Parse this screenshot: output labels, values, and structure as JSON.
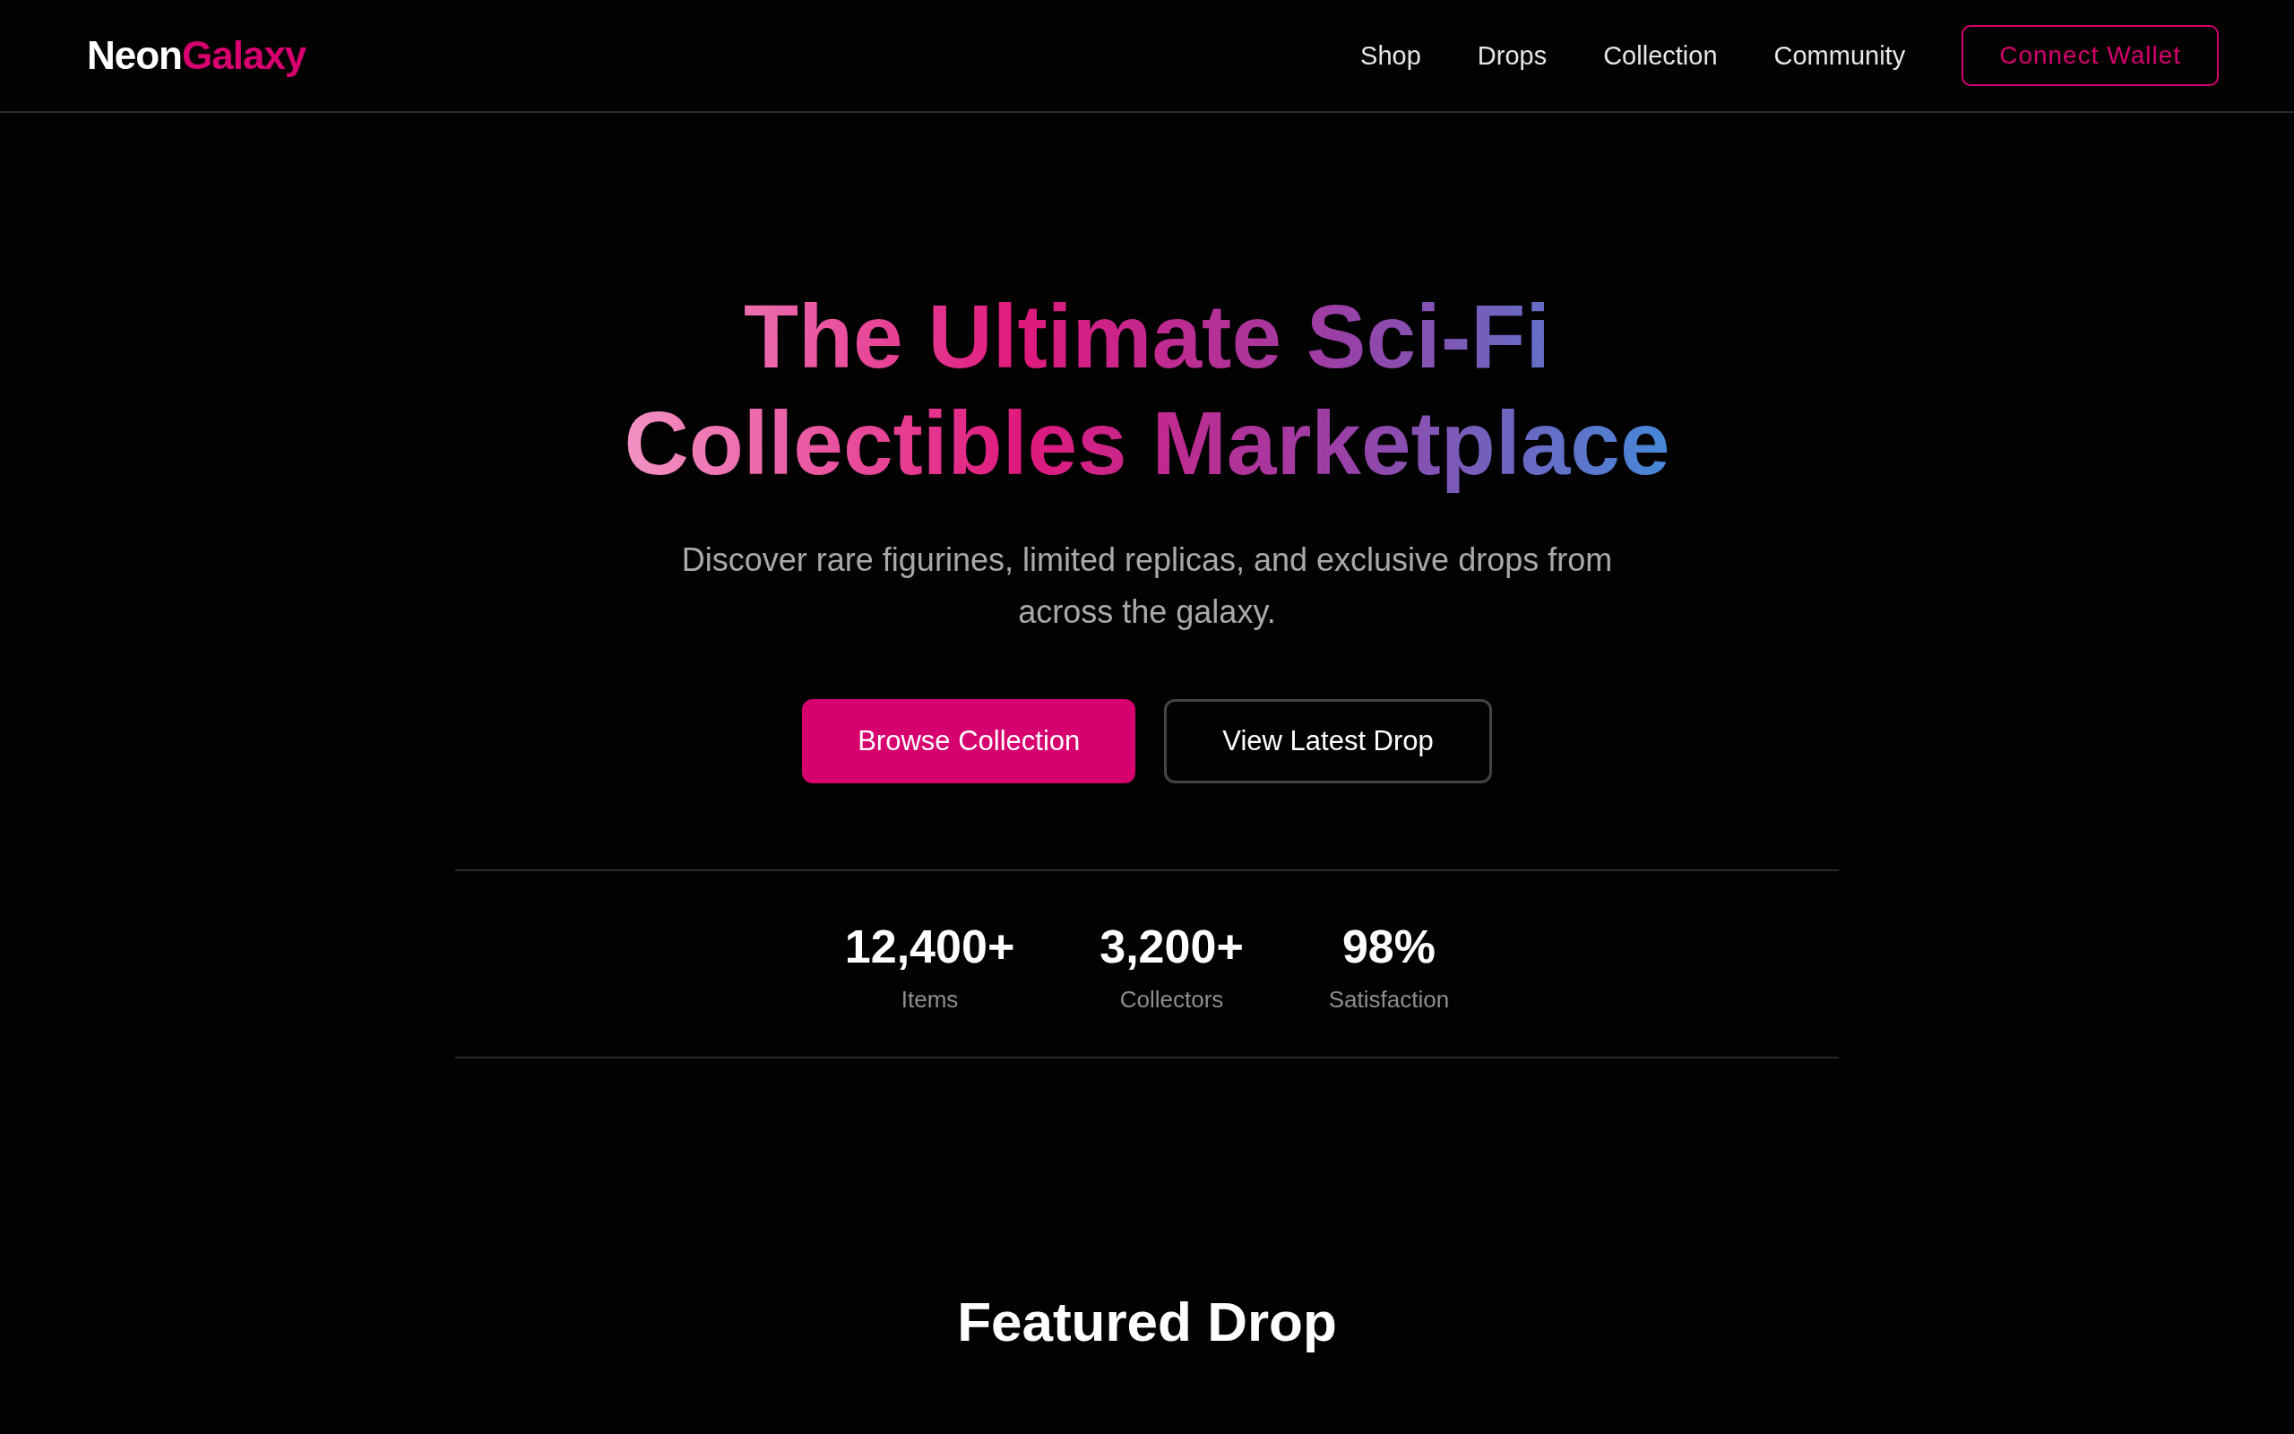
{
  "header": {
    "logo": {
      "primary": "Neon",
      "accent": "Galaxy"
    },
    "nav": [
      {
        "label": "Shop"
      },
      {
        "label": "Drops"
      },
      {
        "label": "Collection"
      },
      {
        "label": "Community"
      }
    ],
    "wallet_button": "Connect Wallet"
  },
  "hero": {
    "title": "The Ultimate Sci-Fi Collectibles Marketplace",
    "subtitle": "Discover rare figurines, limited replicas, and exclusive drops from across the galaxy.",
    "buttons": [
      {
        "label": "Browse Collection",
        "kind": "primary"
      },
      {
        "label": "View Latest Drop",
        "kind": "outline"
      }
    ],
    "stats": [
      {
        "value": "12,400+",
        "label": "Items"
      },
      {
        "value": "3,200+",
        "label": "Collectors"
      },
      {
        "value": "98%",
        "label": "Satisfaction"
      }
    ]
  },
  "featured": {
    "heading": "Featured Drop"
  }
}
